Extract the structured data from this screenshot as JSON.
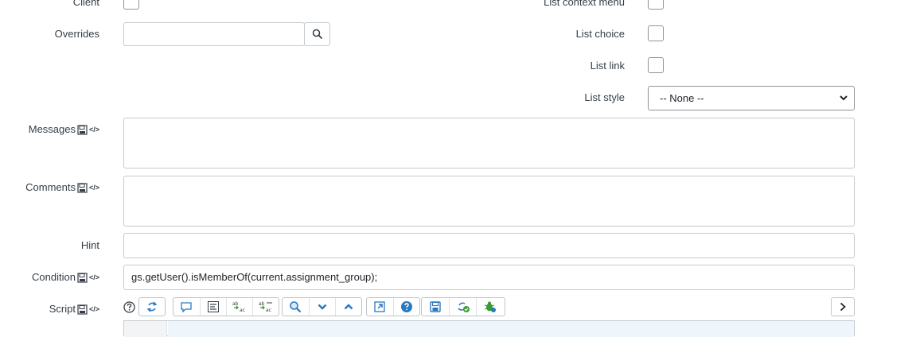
{
  "left_fields": {
    "client_label": "Client",
    "overrides_label": "Overrides",
    "messages_label": "Messages",
    "comments_label": "Comments",
    "hint_label": "Hint",
    "condition_label": "Condition",
    "script_label": "Script",
    "code_icon_text": "</>"
  },
  "right_fields": {
    "list_context_menu_label": "List context menu",
    "list_choice_label": "List choice",
    "list_link_label": "List link",
    "list_style_label": "List style",
    "list_style_value": "-- None --"
  },
  "values": {
    "condition": "gs.getUser().isMemberOf(current.assignment_group);",
    "hint": "",
    "messages": "",
    "comments": "",
    "overrides": ""
  },
  "colors": {
    "text": "#343d47",
    "border": "#c5c9cf",
    "icon_blue": "#2a78c2",
    "icon_green": "#3c9c34"
  }
}
